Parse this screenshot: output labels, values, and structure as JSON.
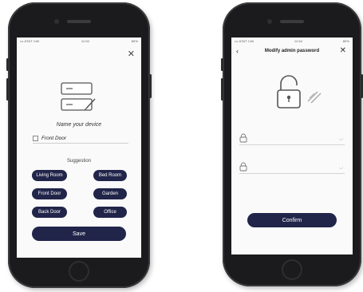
{
  "left_screen": {
    "status": {
      "carrier": "••• AT&T Cell",
      "time": "11:52",
      "battery": "80%"
    },
    "name_title": "Name your device",
    "device_name_value": "Front Door",
    "suggestion_title": "Suggestion",
    "suggestions": [
      "Living Room",
      "Bed Room",
      "Front Door",
      "Garden",
      "Back Door",
      "Office"
    ],
    "save_label": "Save"
  },
  "right_screen": {
    "status": {
      "carrier": "••• AT&T Cell",
      "time": "11:54",
      "battery": "80%"
    },
    "title": "Modify admin password",
    "confirm_label": "Confirm"
  },
  "colors": {
    "primary_button": "#21254a",
    "phone_body": "#1b1b1d"
  },
  "icons": [
    "close-icon",
    "device-edit-icon",
    "unlock-icon",
    "lock-icon",
    "eye-icon",
    "back-arrow-icon"
  ]
}
